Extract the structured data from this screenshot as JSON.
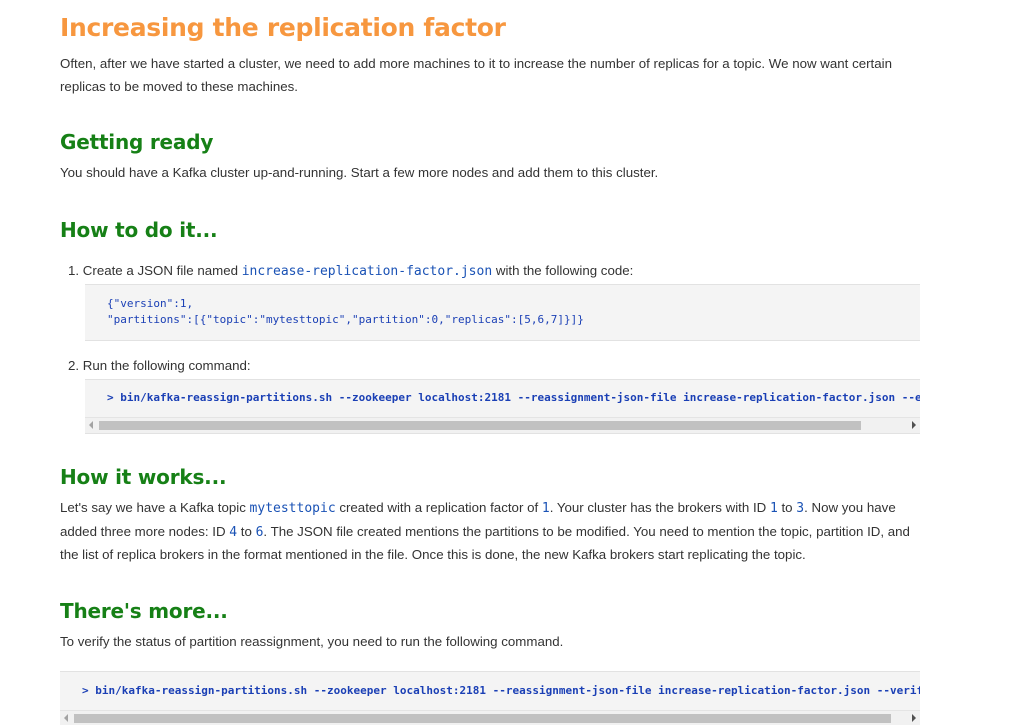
{
  "title": "Increasing the replication factor",
  "intro": "Often, after we have started a cluster, we need to add more machines to it to increase the number of replicas for a topic. We now want certain replicas to be moved to these machines.",
  "getting_ready": {
    "heading": "Getting ready",
    "text": "You should have a Kafka cluster up-and-running. Start a few more nodes and add them to this cluster."
  },
  "how_to": {
    "heading": "How to do it...",
    "step1": {
      "number": "1.",
      "prefix": "Create a JSON file named ",
      "filename": "increase-replication-factor.json",
      "suffix": " with the following code:",
      "code_line1": "{\"version\":1,",
      "code_line2": "\"partitions\":[{\"topic\":\"mytesttopic\",\"partition\":0,\"replicas\":[5,6,7]}]}"
    },
    "step2": {
      "number": "2.",
      "text": "Run the following command:",
      "command": "> bin/kafka-reassign-partitions.sh --zookeeper localhost:2181 --reassignment-json-file increase-replication-factor.json --exe"
    }
  },
  "how_it_works": {
    "heading": "How it works...",
    "t1": "Let's say we have a Kafka topic ",
    "topic": "mytesttopic",
    "t2": " created with a replication factor of ",
    "rf": "1",
    "t3": ". Your cluster has the brokers with ID ",
    "id_from": "1",
    "t4": " to ",
    "id_to": "3",
    "t5": ". Now you have added three more nodes: ID ",
    "new_from": "4",
    "t6": " to ",
    "new_to": "6",
    "t7": ". The JSON file created mentions the partitions to be modified. You need to mention the topic, partition ID, and the list of replica brokers in the format mentioned in the file. Once this is done, the new Kafka brokers start replicating the topic."
  },
  "theres_more": {
    "heading": "There's more...",
    "text": "To verify the status of partition reassignment, you need to run the following command.",
    "command": "> bin/kafka-reassign-partitions.sh --zookeeper localhost:2181 --reassignment-json-file increase-replication-factor.json --verify"
  },
  "colors": {
    "title": "#f7973f",
    "heading": "#168016",
    "code": "#1a3fb5",
    "code_bg": "#f4f4f4"
  },
  "icons": {
    "scroll_left": "triangle-left",
    "scroll_right": "triangle-right"
  }
}
